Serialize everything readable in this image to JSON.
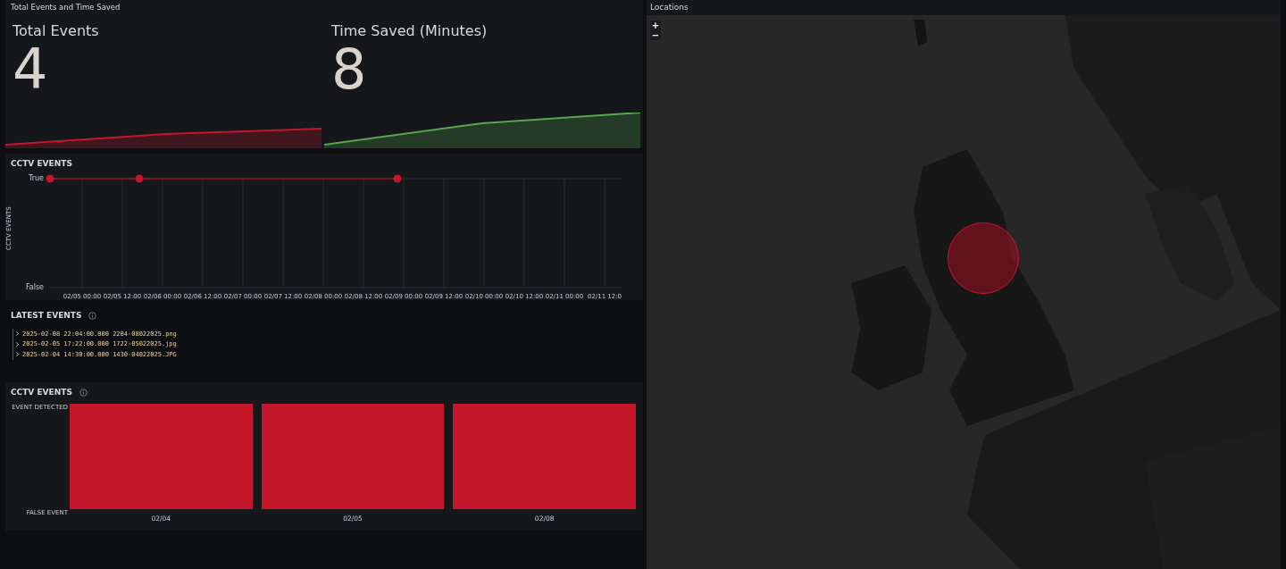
{
  "stats_panel": {
    "title": "Total Events and Time Saved",
    "stats": [
      {
        "label": "Total Events",
        "value": "4",
        "color": "#c4162a"
      },
      {
        "label": "Time Saved (Minutes)",
        "value": "8",
        "color": "#56a64b"
      }
    ]
  },
  "timeline_panel": {
    "title": "CCTV EVENTS",
    "y_axis_title": "CCTV EVENTS",
    "y_labels": [
      "True",
      "False"
    ],
    "x_labels": [
      "02/05 00:00",
      "02/05 12:00",
      "02/06 00:00",
      "02/06 12:00",
      "02/07 00:00",
      "02/07 12:00",
      "02/08 00:00",
      "02/08 12:00",
      "02/09 00:00",
      "02/09 12:00",
      "02/10 00:00",
      "02/10 12:00",
      "02/11 00:00",
      "02/11 12:0"
    ]
  },
  "latest_events": {
    "title": "LATEST EVENTS",
    "rows": [
      {
        "time": "2025-02-08 22:04:00.000",
        "file": "2204-08022025.png"
      },
      {
        "time": "2025-02-05 17:22:00.000",
        "file": "1722-05022025.jpg"
      },
      {
        "time": "2025-02-04 14:30:00.000",
        "file": "1430-04022025.JPG"
      }
    ]
  },
  "bar_panel": {
    "title": "CCTV EVENTS",
    "y_labels": [
      "EVENT DETECTED",
      "FALSE EVENT"
    ],
    "bars": [
      "02/04",
      "02/05",
      "02/08"
    ]
  },
  "map_panel": {
    "title": "Locations",
    "zoom_in": "+",
    "zoom_out": "−"
  }
}
